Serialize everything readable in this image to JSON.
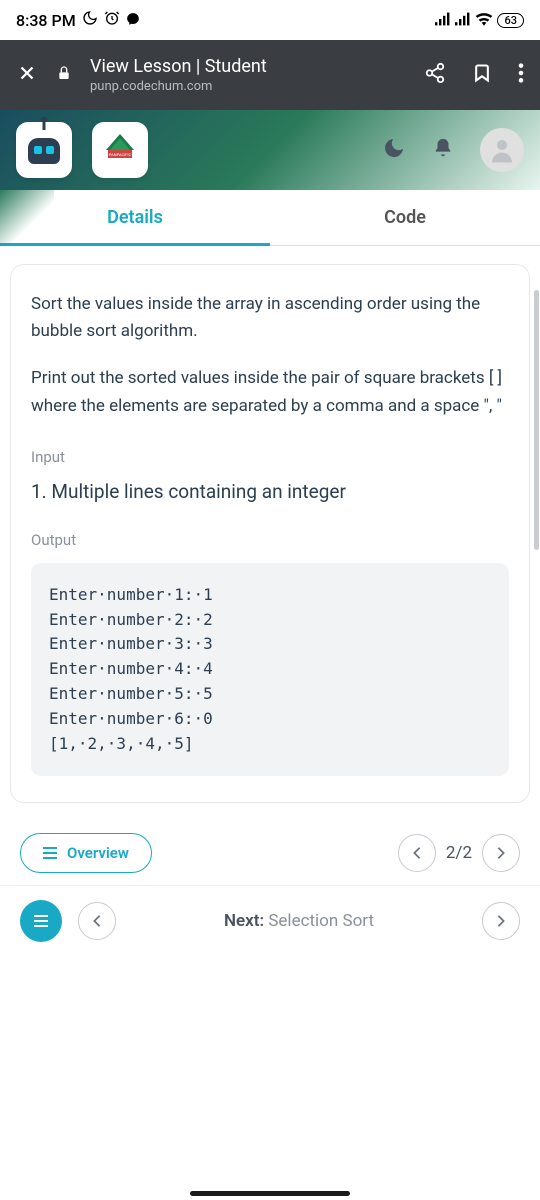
{
  "statusBar": {
    "time": "8:38 PM",
    "battery": "63"
  },
  "browser": {
    "title": "View Lesson | Student",
    "url": "punp.codechum.com"
  },
  "tabs": {
    "details": "Details",
    "code": "Code"
  },
  "problem": {
    "para1": "Sort the values inside the array in ascending order using the bubble sort algorithm.",
    "para2": "Print out the sorted values inside the pair of square brackets [ ] where the elements are separated by a comma and a space \", \""
  },
  "sections": {
    "inputLabel": "Input",
    "inputDesc": "1. Multiple lines containing an integer",
    "outputLabel": "Output",
    "outputSample": "Enter·number·1:·1\nEnter·number·2:·2\nEnter·number·3:·3\nEnter·number·4:·4\nEnter·number·5:·5\nEnter·number·6:·0\n[1,·2,·3,·4,·5]"
  },
  "nav": {
    "overview": "Overview",
    "page": "2/2",
    "nextLabel": "Next:",
    "nextTitle": "Selection Sort"
  }
}
